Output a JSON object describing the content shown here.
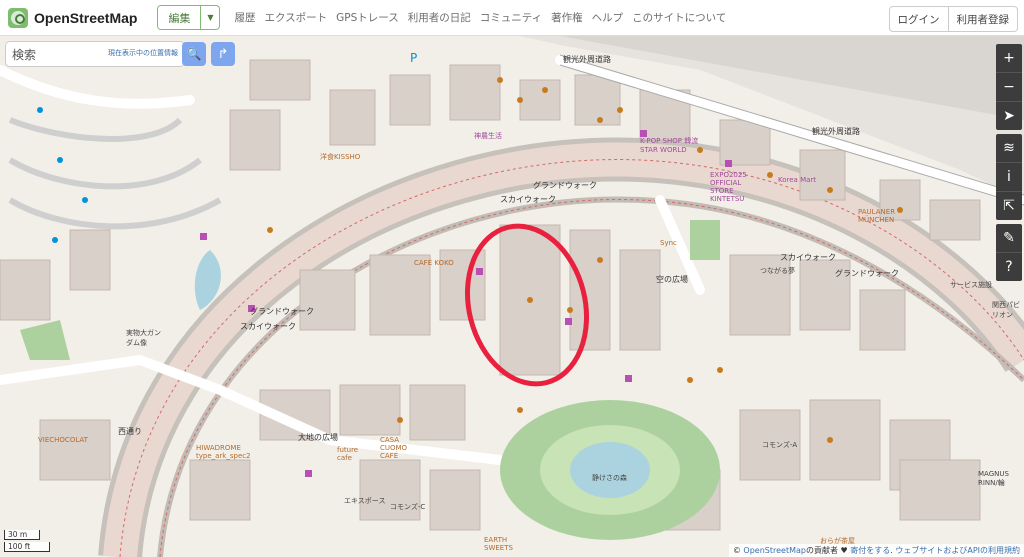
{
  "header": {
    "logo_text": "OpenStreetMap",
    "edit_label": "編集",
    "nav": [
      "履歴",
      "エクスポート",
      "GPSトレース",
      "利用者の日記",
      "コミュニティ",
      "著作権",
      "ヘルプ",
      "このサイトについて"
    ],
    "login_label": "ログイン",
    "signup_label": "利用者登録"
  },
  "search": {
    "placeholder": "検索",
    "where_am_i": "現在表示中の位置情報"
  },
  "map": {
    "roads": [
      "観光外周道路",
      "観光外周道路",
      "スカイウォーク",
      "グランドウォーク",
      "スカイウォーク",
      "グランドウォーク",
      "スカイウォーク",
      "グランドウォーク",
      "西通り"
    ],
    "places": [
      "神農生活",
      "洋食KISSHO",
      "K-POP SHOP 韓流STAR WORLD",
      "EXPO2025 OFFICIAL STORE KINTETSU",
      "Korea Mart",
      "PAULANER MÜNCHEN",
      "CAFÉ KOKO",
      "Sync",
      "空の広場",
      "サービス施設",
      "関西パビリオン",
      "実物大ガンダム像",
      "VIECHOCOLAT",
      "HIWADROME type_ark_spec2",
      "大地の広場",
      "CASA CUOMO CAFÉ",
      "future cafe",
      "コモンズ-A",
      "MAGNUS RINN/輪",
      "コモンズ-C",
      "静けさの森",
      "EARTH SWEETS",
      "エキスポース",
      "おらが茶屋",
      "つながる夢"
    ],
    "scale_metric": "30 m",
    "scale_imperial": "100 ft",
    "annotation_color": "#e8213f"
  },
  "controls": [
    "zoom-in",
    "zoom-out",
    "locate",
    "layers",
    "info",
    "share",
    "note",
    "query"
  ],
  "attribution": {
    "prefix": "© ",
    "osm_link": "OpenStreetMap",
    "contributors": "の貢献者",
    "heart": " ♥ ",
    "donate": "寄付をする",
    "sep": ". ",
    "terms": "ウェブサイトおよびAPIの利用規約"
  }
}
